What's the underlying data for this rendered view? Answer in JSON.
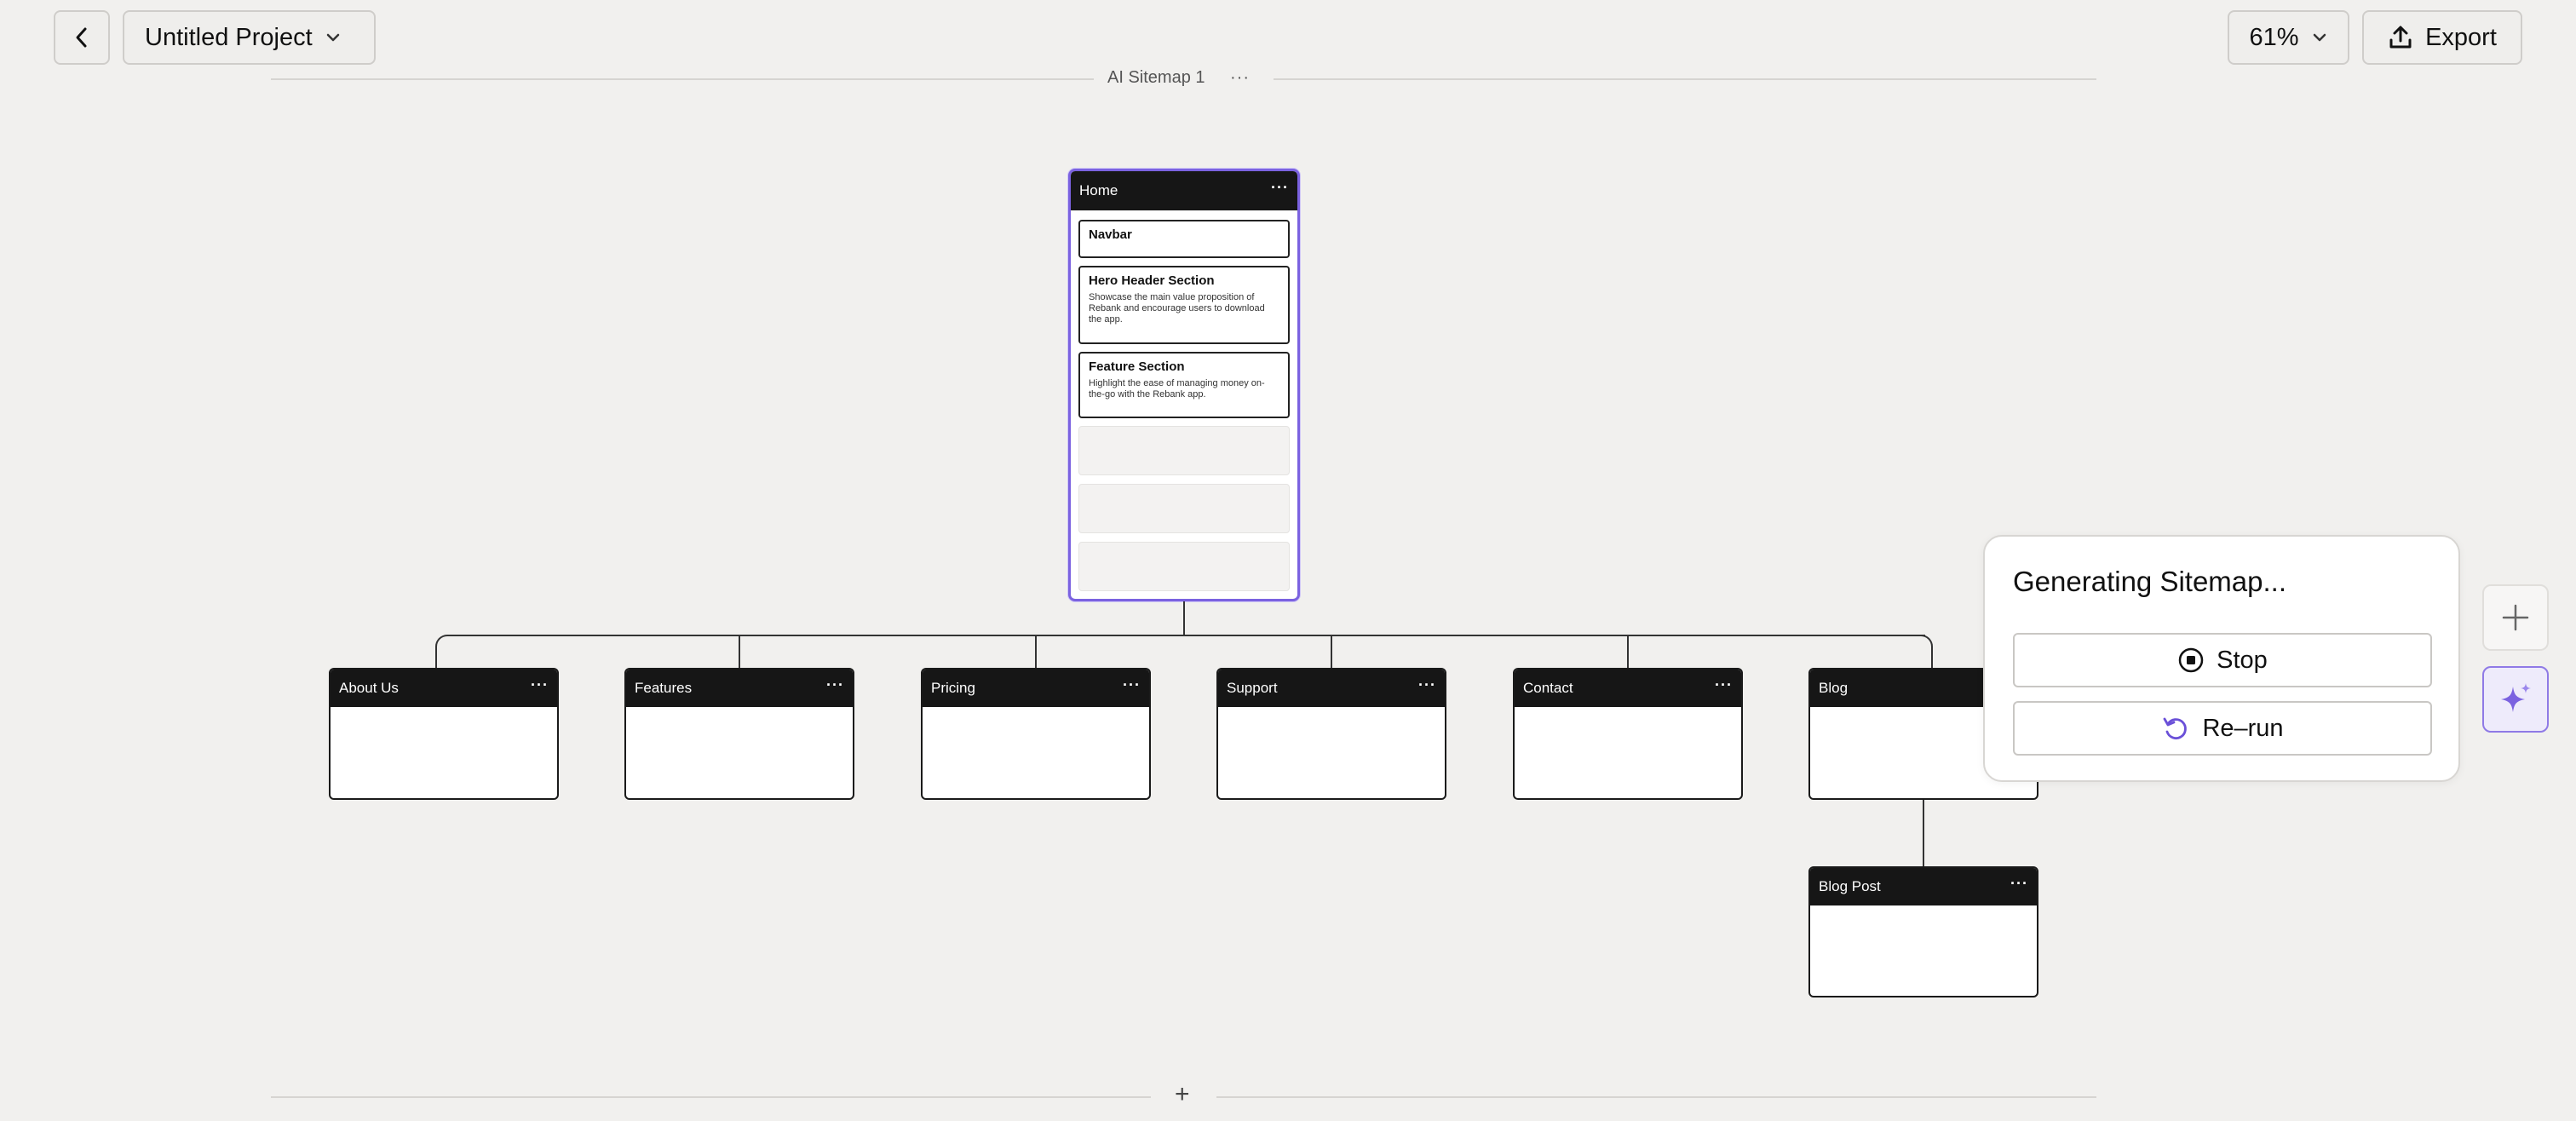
{
  "topbar": {
    "back_icon": "chevron-left-icon",
    "project_name": "Untitled Project",
    "zoom": "61%",
    "export_label": "Export"
  },
  "canvas": {
    "sitemap_title": "AI Sitemap 1",
    "sitemap_menu": "···"
  },
  "home": {
    "title": "Home",
    "menu": "···",
    "sections": [
      {
        "title": "Navbar",
        "desc": ""
      },
      {
        "title": "Hero Header Section",
        "desc": "Showcase the main value proposition of Rebank and encourage users to download the app."
      },
      {
        "title": "Feature Section",
        "desc": "Highlight the ease of managing money on-the-go with the Rebank app."
      }
    ]
  },
  "pages": [
    {
      "title": "About Us",
      "menu": "···"
    },
    {
      "title": "Features",
      "menu": "···"
    },
    {
      "title": "Pricing",
      "menu": "···"
    },
    {
      "title": "Support",
      "menu": "···"
    },
    {
      "title": "Contact",
      "menu": "···"
    },
    {
      "title": "Blog",
      "menu": "···"
    },
    {
      "title": "Blog Post",
      "menu": "···"
    }
  ],
  "popup": {
    "title": "Generating Sitemap...",
    "stop_label": "Stop",
    "rerun_label": "Re–run"
  },
  "bottom_add": "+",
  "colors": {
    "background": "#f1f0ee",
    "accent": "#7b62e0",
    "card_header": "#161616"
  }
}
